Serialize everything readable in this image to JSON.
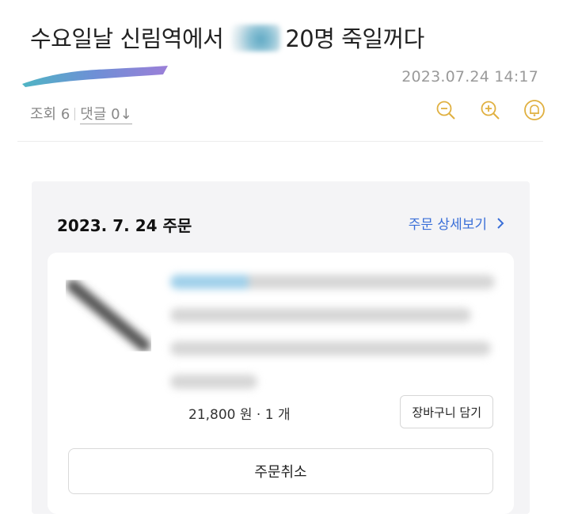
{
  "post": {
    "title_before": "수요일날 신림역에서",
    "title_after": "20명 죽일꺼다",
    "date": "2023.07.24 14:17",
    "views_label": "조회 6",
    "comments_label": "댓글 0↓"
  },
  "tools": [
    {
      "name": "zoom-out-icon",
      "label": "−"
    },
    {
      "name": "zoom-in-icon",
      "label": "+"
    },
    {
      "name": "notification-icon",
      "label": "bell"
    }
  ],
  "order": {
    "date_heading": "2023. 7. 24 주문",
    "detail_link": "주문 상세보기",
    "chevron": "›",
    "price_line": "21,800 원 · 1 개",
    "cart_button": "장바구니 담기",
    "cancel_button": "주문취소"
  },
  "colors": {
    "accent_link": "#3a6fd8",
    "tool_icon": "#e0b040"
  }
}
